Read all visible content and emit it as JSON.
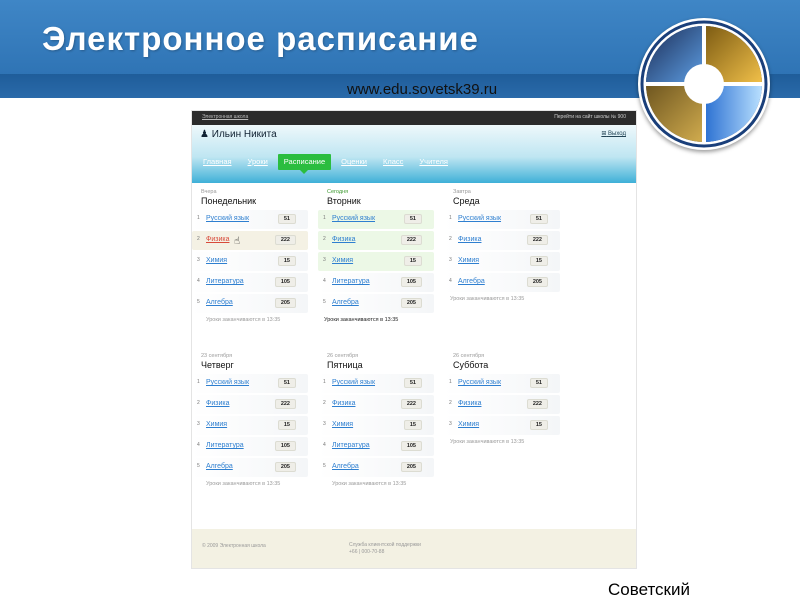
{
  "slide": {
    "title": "Электронное расписание",
    "url": "www.edu.sovetsk39.ru",
    "bottom_text": "Советский"
  },
  "app": {
    "topbar_left": "Электронная школа",
    "topbar_right": "Перейти на сайт школы № 900",
    "username": "Ильин Никита",
    "logout": "Выход",
    "nav": [
      {
        "label": "Главная",
        "active": false
      },
      {
        "label": "Уроки",
        "active": false
      },
      {
        "label": "Расписание",
        "active": true
      },
      {
        "label": "Оценки",
        "active": false
      },
      {
        "label": "Класс",
        "active": false
      },
      {
        "label": "Учителя",
        "active": false
      }
    ],
    "days": [
      {
        "label": "Вчера",
        "name": "Понедельник",
        "note": "Уроки заканчиваются в 13:35",
        "lessons": [
          {
            "num": "1",
            "subject": "Русский язык",
            "room": "51"
          },
          {
            "num": "2",
            "subject": "Физика",
            "room": "222"
          },
          {
            "num": "3",
            "subject": "Химия",
            "room": "15"
          },
          {
            "num": "4",
            "subject": "Литература",
            "room": "105"
          },
          {
            "num": "5",
            "subject": "Алгебра",
            "room": "205"
          }
        ]
      },
      {
        "label": "Сегодня",
        "name": "Вторник",
        "note": "Уроки заканчиваются в 13:35",
        "lessons": [
          {
            "num": "1",
            "subject": "Русский язык",
            "room": "51"
          },
          {
            "num": "2",
            "subject": "Физика",
            "room": "222"
          },
          {
            "num": "3",
            "subject": "Химия",
            "room": "15"
          },
          {
            "num": "4",
            "subject": "Литература",
            "room": "105"
          },
          {
            "num": "5",
            "subject": "Алгебра",
            "room": "205"
          }
        ]
      },
      {
        "label": "Завтра",
        "name": "Среда",
        "note": "Уроки заканчиваются в 13:35",
        "lessons": [
          {
            "num": "1",
            "subject": "Русский язык",
            "room": "51"
          },
          {
            "num": "2",
            "subject": "Физика",
            "room": "222"
          },
          {
            "num": "3",
            "subject": "Химия",
            "room": "15"
          },
          {
            "num": "4",
            "subject": "Алгебра",
            "room": "205"
          }
        ]
      },
      {
        "label": "23 сентября",
        "name": "Четверг",
        "note": "Уроки заканчиваются в 13:35",
        "lessons": [
          {
            "num": "1",
            "subject": "Русский язык",
            "room": "51"
          },
          {
            "num": "2",
            "subject": "Физика",
            "room": "222"
          },
          {
            "num": "3",
            "subject": "Химия",
            "room": "15"
          },
          {
            "num": "4",
            "subject": "Литература",
            "room": "105"
          },
          {
            "num": "5",
            "subject": "Алгебра",
            "room": "205"
          }
        ]
      },
      {
        "label": "26 сентября",
        "name": "Пятница",
        "note": "Уроки заканчиваются в 13:35",
        "lessons": [
          {
            "num": "1",
            "subject": "Русский язык",
            "room": "51"
          },
          {
            "num": "2",
            "subject": "Физика",
            "room": "222"
          },
          {
            "num": "3",
            "subject": "Химия",
            "room": "15"
          },
          {
            "num": "4",
            "subject": "Литература",
            "room": "105"
          },
          {
            "num": "5",
            "subject": "Алгебра",
            "room": "205"
          }
        ]
      },
      {
        "label": "26 сентября",
        "name": "Суббота",
        "note": "Уроки заканчиваются в 13:35",
        "lessons": [
          {
            "num": "1",
            "subject": "Русский язык",
            "room": "51"
          },
          {
            "num": "2",
            "subject": "Физика",
            "room": "222"
          },
          {
            "num": "3",
            "subject": "Химия",
            "room": "15"
          }
        ]
      }
    ],
    "footer_left": "© 2009 Электронная школа",
    "footer_right_1": "Служба клиентской поддержки",
    "footer_right_2": "+66 | 000-70-88"
  },
  "colors": {
    "header_blue": "#3f86c6",
    "nav_active_green": "#2bbd3f",
    "link_blue": "#2e7fd0"
  }
}
